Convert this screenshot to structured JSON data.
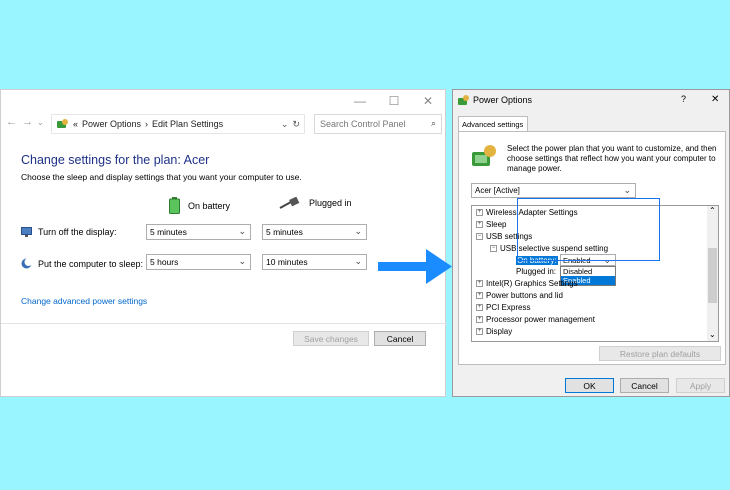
{
  "edit_window": {
    "title_controls": {
      "minimize": "—",
      "maximize": "☐",
      "close": "✕"
    },
    "breadcrumb": [
      "«",
      "Power Options",
      "›",
      "Edit Plan Settings"
    ],
    "search_placeholder": "Search Control Panel",
    "heading": "Change settings for the plan: Acer",
    "subtitle": "Choose the sleep and display settings that you want your computer to use.",
    "columns": {
      "on_battery": "On battery",
      "plugged_in": "Plugged in"
    },
    "rows": [
      {
        "label": "Turn off the display:",
        "battery": "5 minutes",
        "plugged": "5 minutes"
      },
      {
        "label": "Put the computer to sleep:",
        "battery": "5 hours",
        "plugged": "10 minutes"
      }
    ],
    "advanced_link": "Change advanced power settings",
    "save_button": "Save changes",
    "cancel_button": "Cancel"
  },
  "dialog": {
    "title": "Power Options",
    "help": "?",
    "close": "✕",
    "tab": "Advanced settings",
    "description": "Select the power plan that you want to customize, and then choose settings that reflect how you want your computer to manage power.",
    "plan_select": "Acer [Active]",
    "tree": {
      "wireless": "Wireless Adapter Settings",
      "sleep": "Sleep",
      "usb": "USB settings",
      "usb_suspend": "USB selective suspend setting",
      "on_battery_label": "On battery:",
      "on_battery_value": "Enabled",
      "plugged_in_label": "Plugged in:",
      "dropdown_options": [
        "Disabled",
        "Enabled"
      ],
      "intel": "Intel(R) Graphics Settings",
      "power_buttons": "Power buttons and lid",
      "pci": "PCI Express",
      "processor": "Processor power management",
      "display": "Display"
    },
    "restore_button": "Restore plan defaults",
    "ok_button": "OK",
    "cancel_button": "Cancel",
    "apply_button": "Apply"
  },
  "colors": {
    "background": "#99f5ff",
    "arrow": "#1a8cff",
    "heading": "#1e3287",
    "link": "#0066cc",
    "highlight": "#0078d7"
  }
}
